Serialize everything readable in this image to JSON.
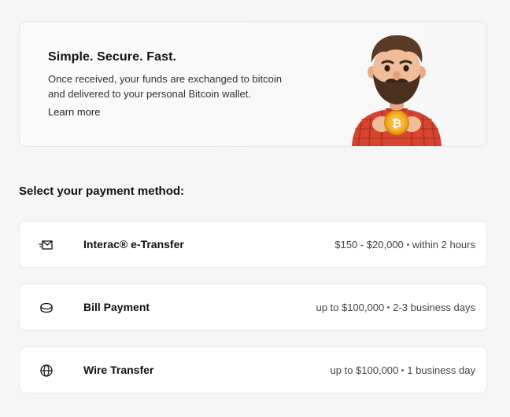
{
  "hero": {
    "title": "Simple. Secure. Fast.",
    "body": "Once received, your funds are exchanged to bitcoin and delivered to your personal Bitcoin wallet.",
    "link": "Learn more",
    "illustration": "bearded-man-holding-bitcoin",
    "coin_symbol": "₿"
  },
  "section_title": "Select your payment method:",
  "methods": [
    {
      "name": "Interac® e-Transfer",
      "icon": "envelope-send-icon",
      "range": "$150 - $20,000",
      "time": "within 2 hours"
    },
    {
      "name": "Bill Payment",
      "icon": "coin-stack-icon",
      "range": "up to $100,000",
      "time": "2-3 business days"
    },
    {
      "name": "Wire Transfer",
      "icon": "globe-icon",
      "range": "up to $100,000",
      "time": "1 business day"
    }
  ]
}
